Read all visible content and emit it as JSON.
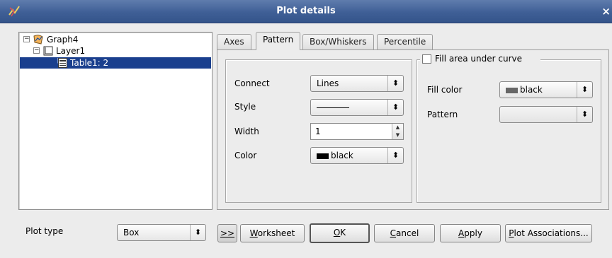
{
  "window": {
    "title": "Plot details",
    "close_glyph": "×"
  },
  "tree": {
    "items": [
      {
        "label": "Graph4",
        "expander": "−",
        "icon": "graph-icon"
      },
      {
        "label": "Layer1",
        "expander": "−",
        "icon": "layer-icon"
      },
      {
        "label": "Table1: 2",
        "icon": "table-icon",
        "selected": true
      }
    ]
  },
  "tabs": [
    "Axes",
    "Pattern",
    "Box/Whiskers",
    "Percentile"
  ],
  "active_tab": "Pattern",
  "line_group": {
    "connect_label": "Connect",
    "connect_value": "Lines",
    "style_label": "Style",
    "width_label": "Width",
    "width_value": "1",
    "color_label": "Color",
    "color_value": "black"
  },
  "fill_group": {
    "checkbox_label": "Fill area under curve",
    "checked": false,
    "fill_color_label": "Fill color",
    "fill_color_value": "black",
    "pattern_label": "Pattern",
    "pattern_value": ""
  },
  "bottom": {
    "plot_type_label": "Plot type",
    "plot_type_value": "Box",
    "toggle_label": ">>",
    "worksheet_u": "W",
    "worksheet_rest": "orksheet",
    "ok_u": "O",
    "ok_rest": "K",
    "cancel_u": "C",
    "cancel_rest": "ancel",
    "apply_u": "A",
    "apply_rest": "pply",
    "assoc_u": "P",
    "assoc_rest": "lot Associations..."
  },
  "colors": {
    "titlebar": "#3f5f96",
    "selection": "#1a3f8e"
  }
}
